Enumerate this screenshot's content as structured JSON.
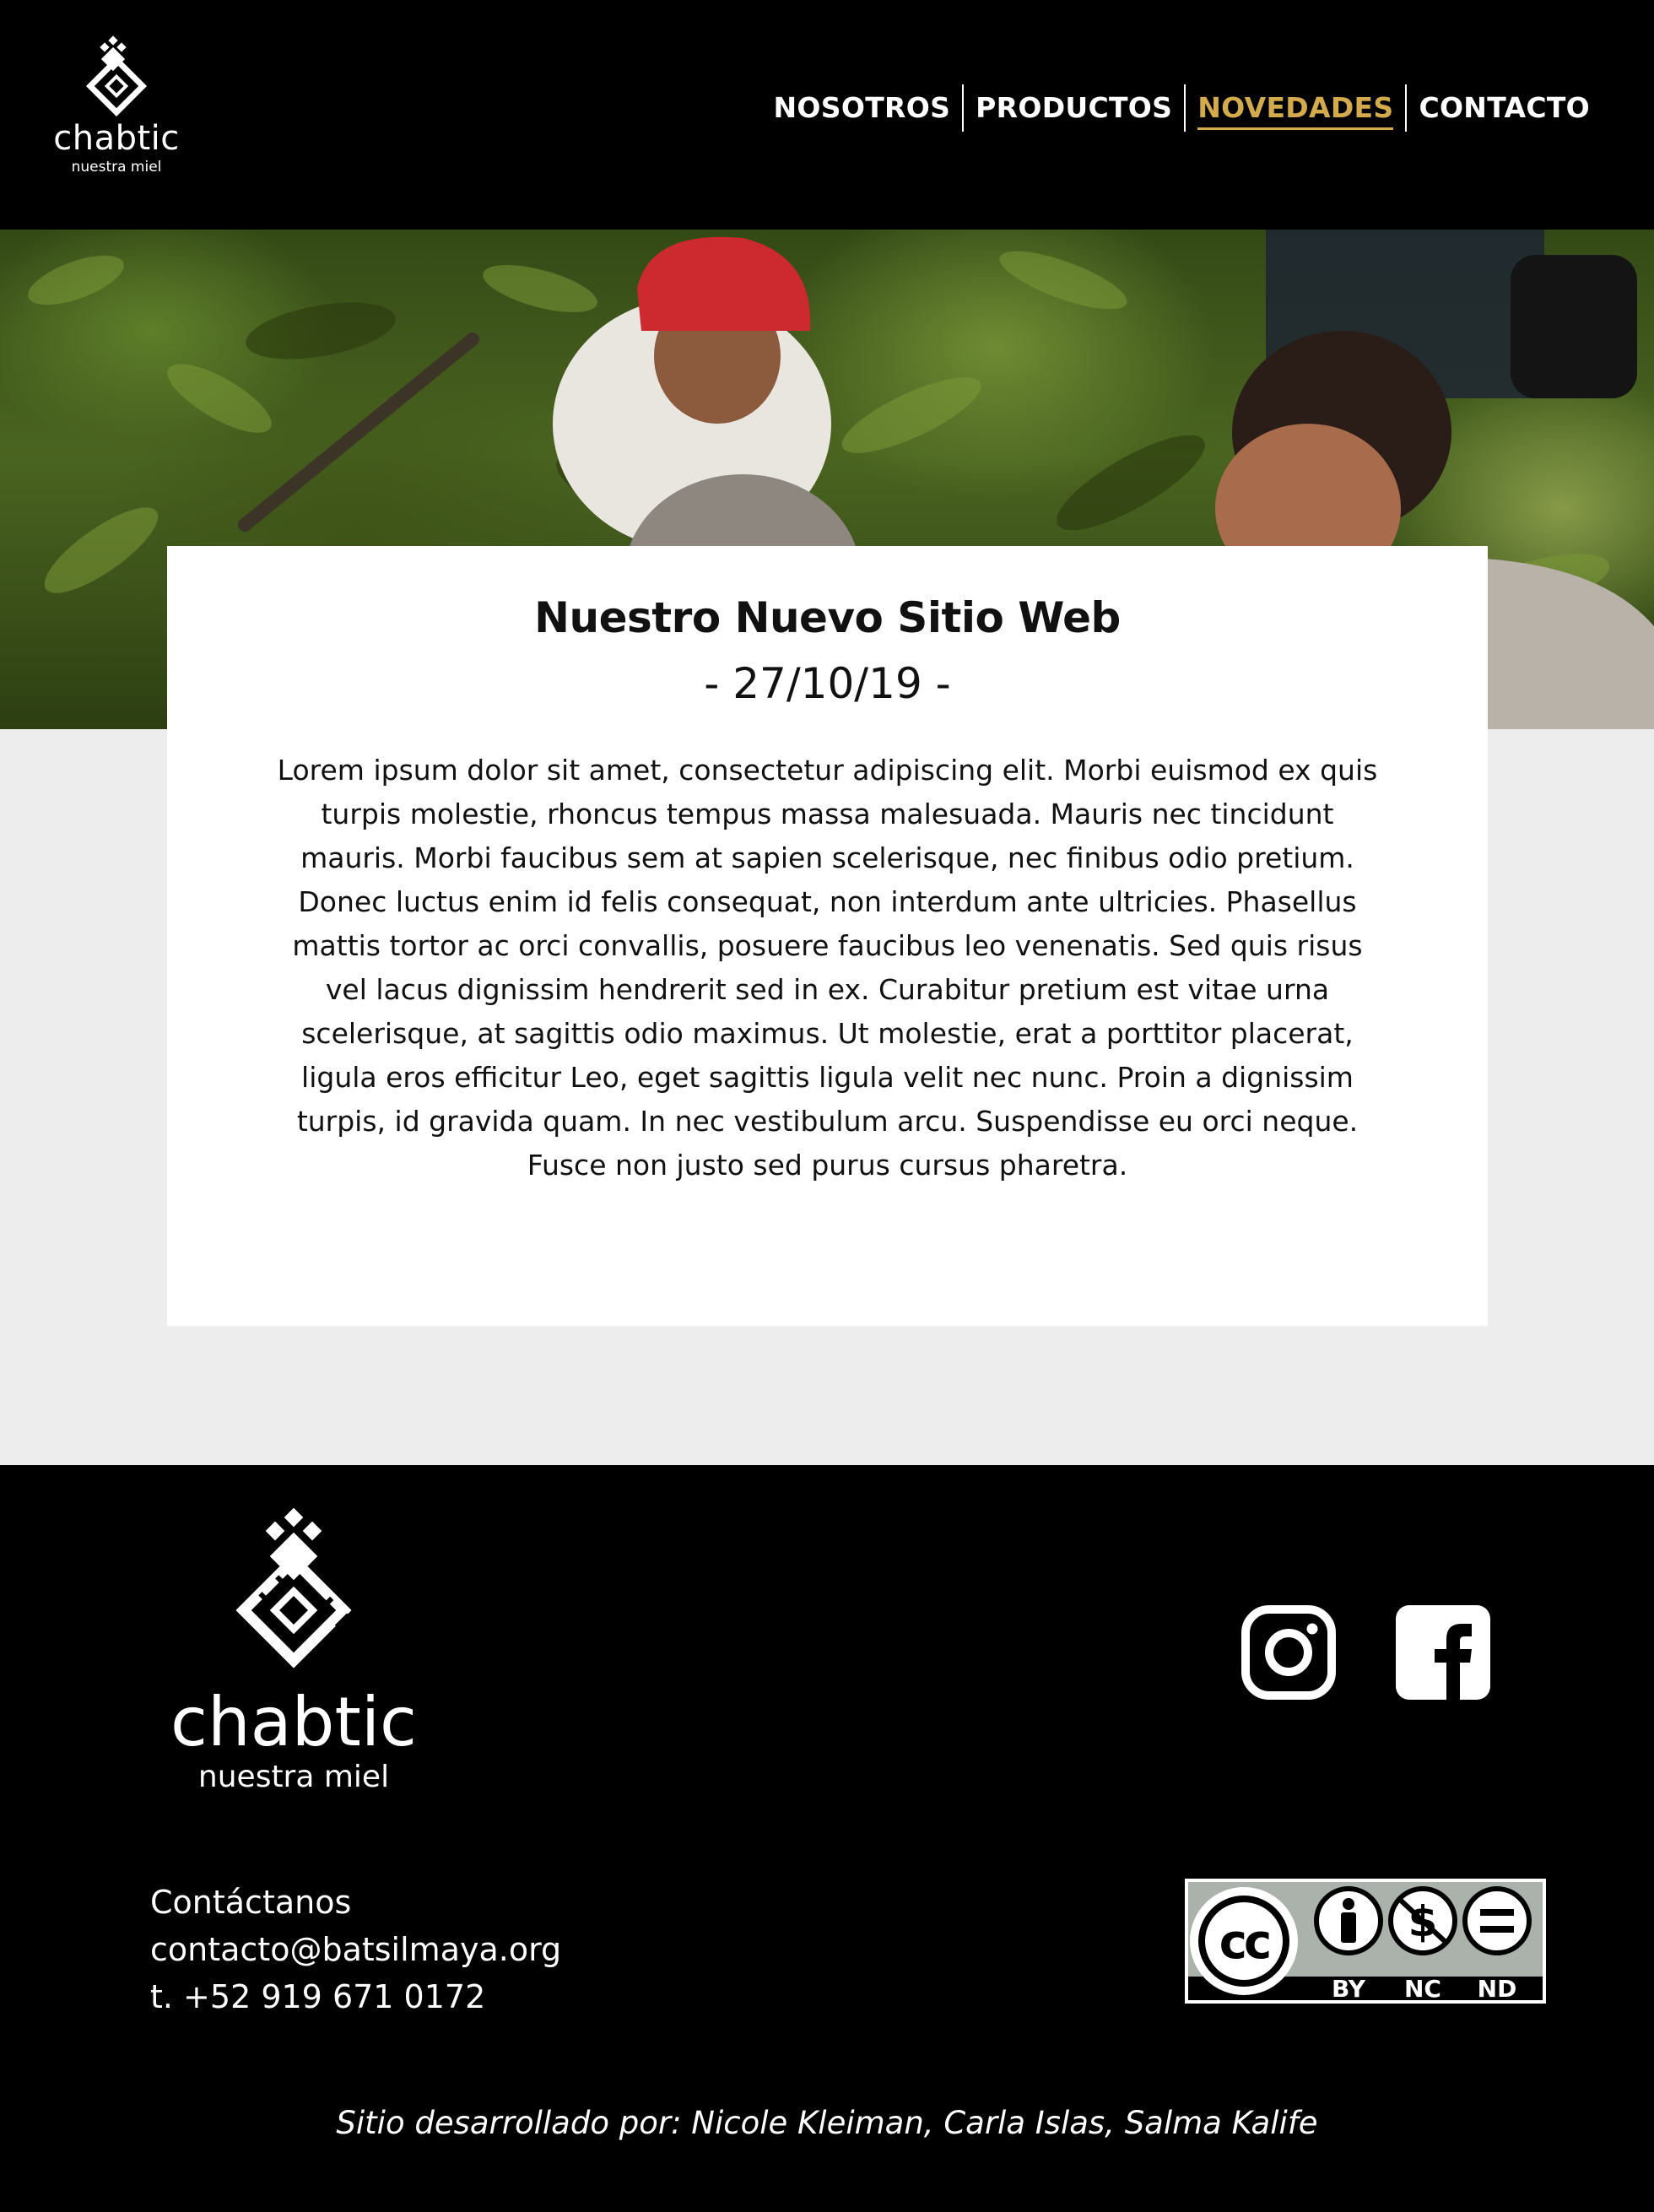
{
  "brand": {
    "name": "chabtic",
    "tagline": "nuestra miel"
  },
  "nav": {
    "items": [
      {
        "label": "NOSOTROS"
      },
      {
        "label": "PRODUCTOS"
      },
      {
        "label": "NOVEDADES",
        "active": true
      },
      {
        "label": "CONTACTO"
      }
    ]
  },
  "colors": {
    "accent": "#d3aa4c",
    "background": "#000000",
    "paper": "#ededed"
  },
  "hero": {
    "image": "photo-beekeepers-in-forest"
  },
  "article": {
    "title": "Nuestro Nuevo Sitio Web",
    "date": "- 27/10/19 -",
    "body": "Lorem ipsum dolor sit amet, consectetur adipiscing elit. Morbi euismod ex quis turpis molestie, rhoncus tempus massa malesuada. Mauris nec tincidunt mauris. Morbi faucibus sem at sapien scelerisque, nec finibus odio pretium. Donec luctus enim id felis consequat, non interdum ante ultricies. Phasellus mattis tortor ac orci convallis, posuere faucibus leo venenatis. Sed quis risus vel lacus dignissim hendrerit sed in ex. Curabitur pretium est vitae urna scelerisque, at sagittis odio maximus. Ut molestie, erat a porttitor placerat, ligula eros efficitur Leo, eget sagittis ligula velit nec nunc. Proin a dignissim turpis, id gravida quam. In nec vestibulum arcu. Suspendisse eu orci neque. Fusce non justo sed purus cursus pharetra."
  },
  "footer": {
    "contact_heading": "Contáctanos",
    "email": "contacto@batsilmaya.org",
    "phone": "t. +52 919 671 0172",
    "social": [
      {
        "icon": "instagram-icon"
      },
      {
        "icon": "facebook-icon"
      }
    ],
    "license": {
      "badge": "cc",
      "terms": [
        "BY",
        "NC",
        "ND"
      ]
    },
    "credit": "Sitio desarrollado por: Nicole Kleiman, Carla Islas, Salma Kalife"
  }
}
